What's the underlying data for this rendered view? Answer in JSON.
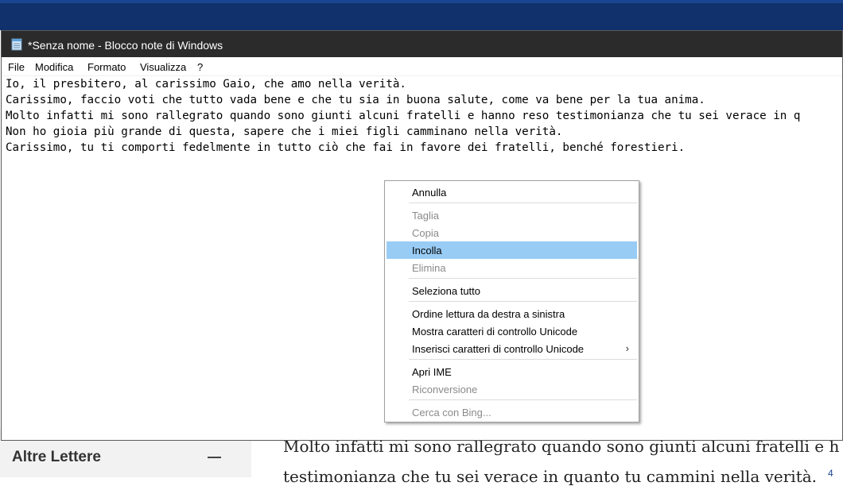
{
  "background": {
    "sidebar_title": "Altre Lettere",
    "content_line1": "Molto infatti mi sono rallegrato quando sono giunti alcuni fratelli e h",
    "content_line2": "testimonianza che tu sei verace in quanto tu cammini nella verità.",
    "verse_number": "4"
  },
  "window": {
    "title": "*Senza nome - Blocco note di Windows",
    "icon": "notepad-icon"
  },
  "menu": {
    "items": [
      "File",
      "Modifica",
      "Formato",
      "Visualizza",
      "?"
    ]
  },
  "editor": {
    "lines": [
      "Io, il presbitero, al carissimo Gaio, che amo nella verità.",
      "Carissimo, faccio voti che tutto vada bene e che tu sia in buona salute, come va bene per la tua anima.",
      "Molto infatti mi sono rallegrato quando sono giunti alcuni fratelli e hanno reso testimonianza che tu sei verace in q",
      "Non ho gioia più grande di questa, sapere che i miei figli camminano nella verità.",
      "Carissimo, tu ti comporti fedelmente in tutto ciò che fai in favore dei fratelli, benché forestieri."
    ]
  },
  "context_menu": {
    "undo": "Annulla",
    "cut": "Taglia",
    "copy": "Copia",
    "paste": "Incolla",
    "delete": "Elimina",
    "select_all": "Seleziona tutto",
    "rtl": "Ordine lettura da destra a sinistra",
    "show_unicode": "Mostra caratteri di controllo Unicode",
    "insert_unicode": "Inserisci caratteri di controllo Unicode",
    "submenu_arrow": "›",
    "open_ime": "Apri IME",
    "reconversion": "Riconversione",
    "bing": "Cerca con Bing..."
  },
  "colors": {
    "highlight": "#99ccf5",
    "titlebar": "#2b2b2b",
    "site_header": "#10316b"
  }
}
